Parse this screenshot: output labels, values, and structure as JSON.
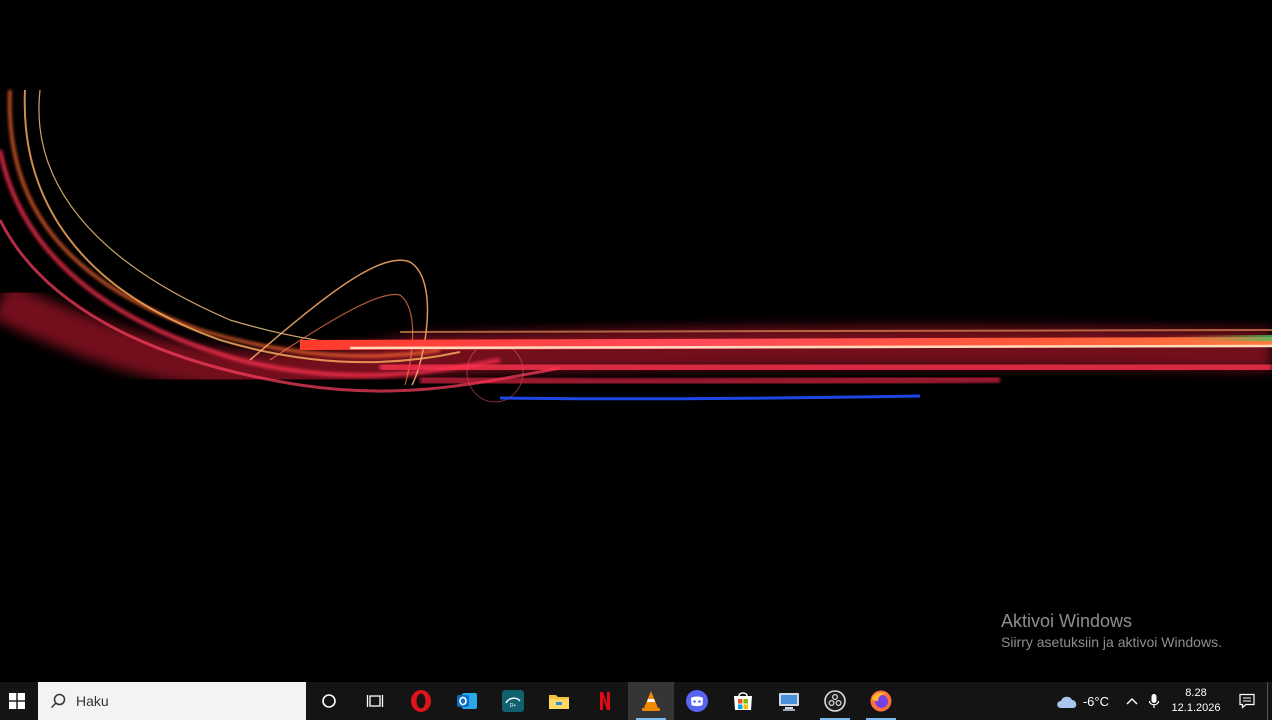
{
  "desktop": {
    "activation_title": "Aktivoi Windows",
    "activation_subtitle": "Siirry asetuksiin ja aktivoi Windows."
  },
  "taskbar": {
    "start_icon": "windows-logo-icon",
    "search_placeholder": "Haku",
    "search_icon": "search-icon",
    "cortana_icon": "cortana-circle-icon",
    "task_view_icon": "task-view-icon",
    "pinned_apps": [
      {
        "name": "opera",
        "icon": "opera-icon",
        "color": "#e0121a"
      },
      {
        "name": "outlook",
        "icon": "outlook-icon",
        "color": "#0a6fc2"
      },
      {
        "name": "disney-plus",
        "icon": "disney-plus-icon",
        "color": "#11606d"
      },
      {
        "name": "file-explorer",
        "icon": "folder-icon",
        "color": "#f3c13a"
      },
      {
        "name": "netflix",
        "icon": "netflix-icon",
        "color": "#e50914"
      },
      {
        "name": "vlc",
        "icon": "vlc-cone-icon",
        "color": "#f08a00"
      },
      {
        "name": "discord",
        "icon": "discord-icon",
        "color": "#5865f2"
      },
      {
        "name": "microsoft-store",
        "icon": "store-icon",
        "color": "#ffffff"
      },
      {
        "name": "remote-desktop",
        "icon": "remote-desktop-icon",
        "color": "#4a90d9"
      },
      {
        "name": "obs",
        "icon": "obs-icon",
        "color": "#dddddd"
      },
      {
        "name": "firefox",
        "icon": "firefox-icon",
        "color": "#ff7139"
      }
    ],
    "active_app": "vlc",
    "running_apps": [
      "vlc",
      "obs",
      "firefox"
    ]
  },
  "tray": {
    "weather_icon": "cloud-icon",
    "temperature": "-6°C",
    "overflow_icon": "chevron-up-icon",
    "mic_icon": "microphone-icon",
    "time": "8.28",
    "date": "12.1.2026",
    "notification_icon": "notification-icon"
  }
}
